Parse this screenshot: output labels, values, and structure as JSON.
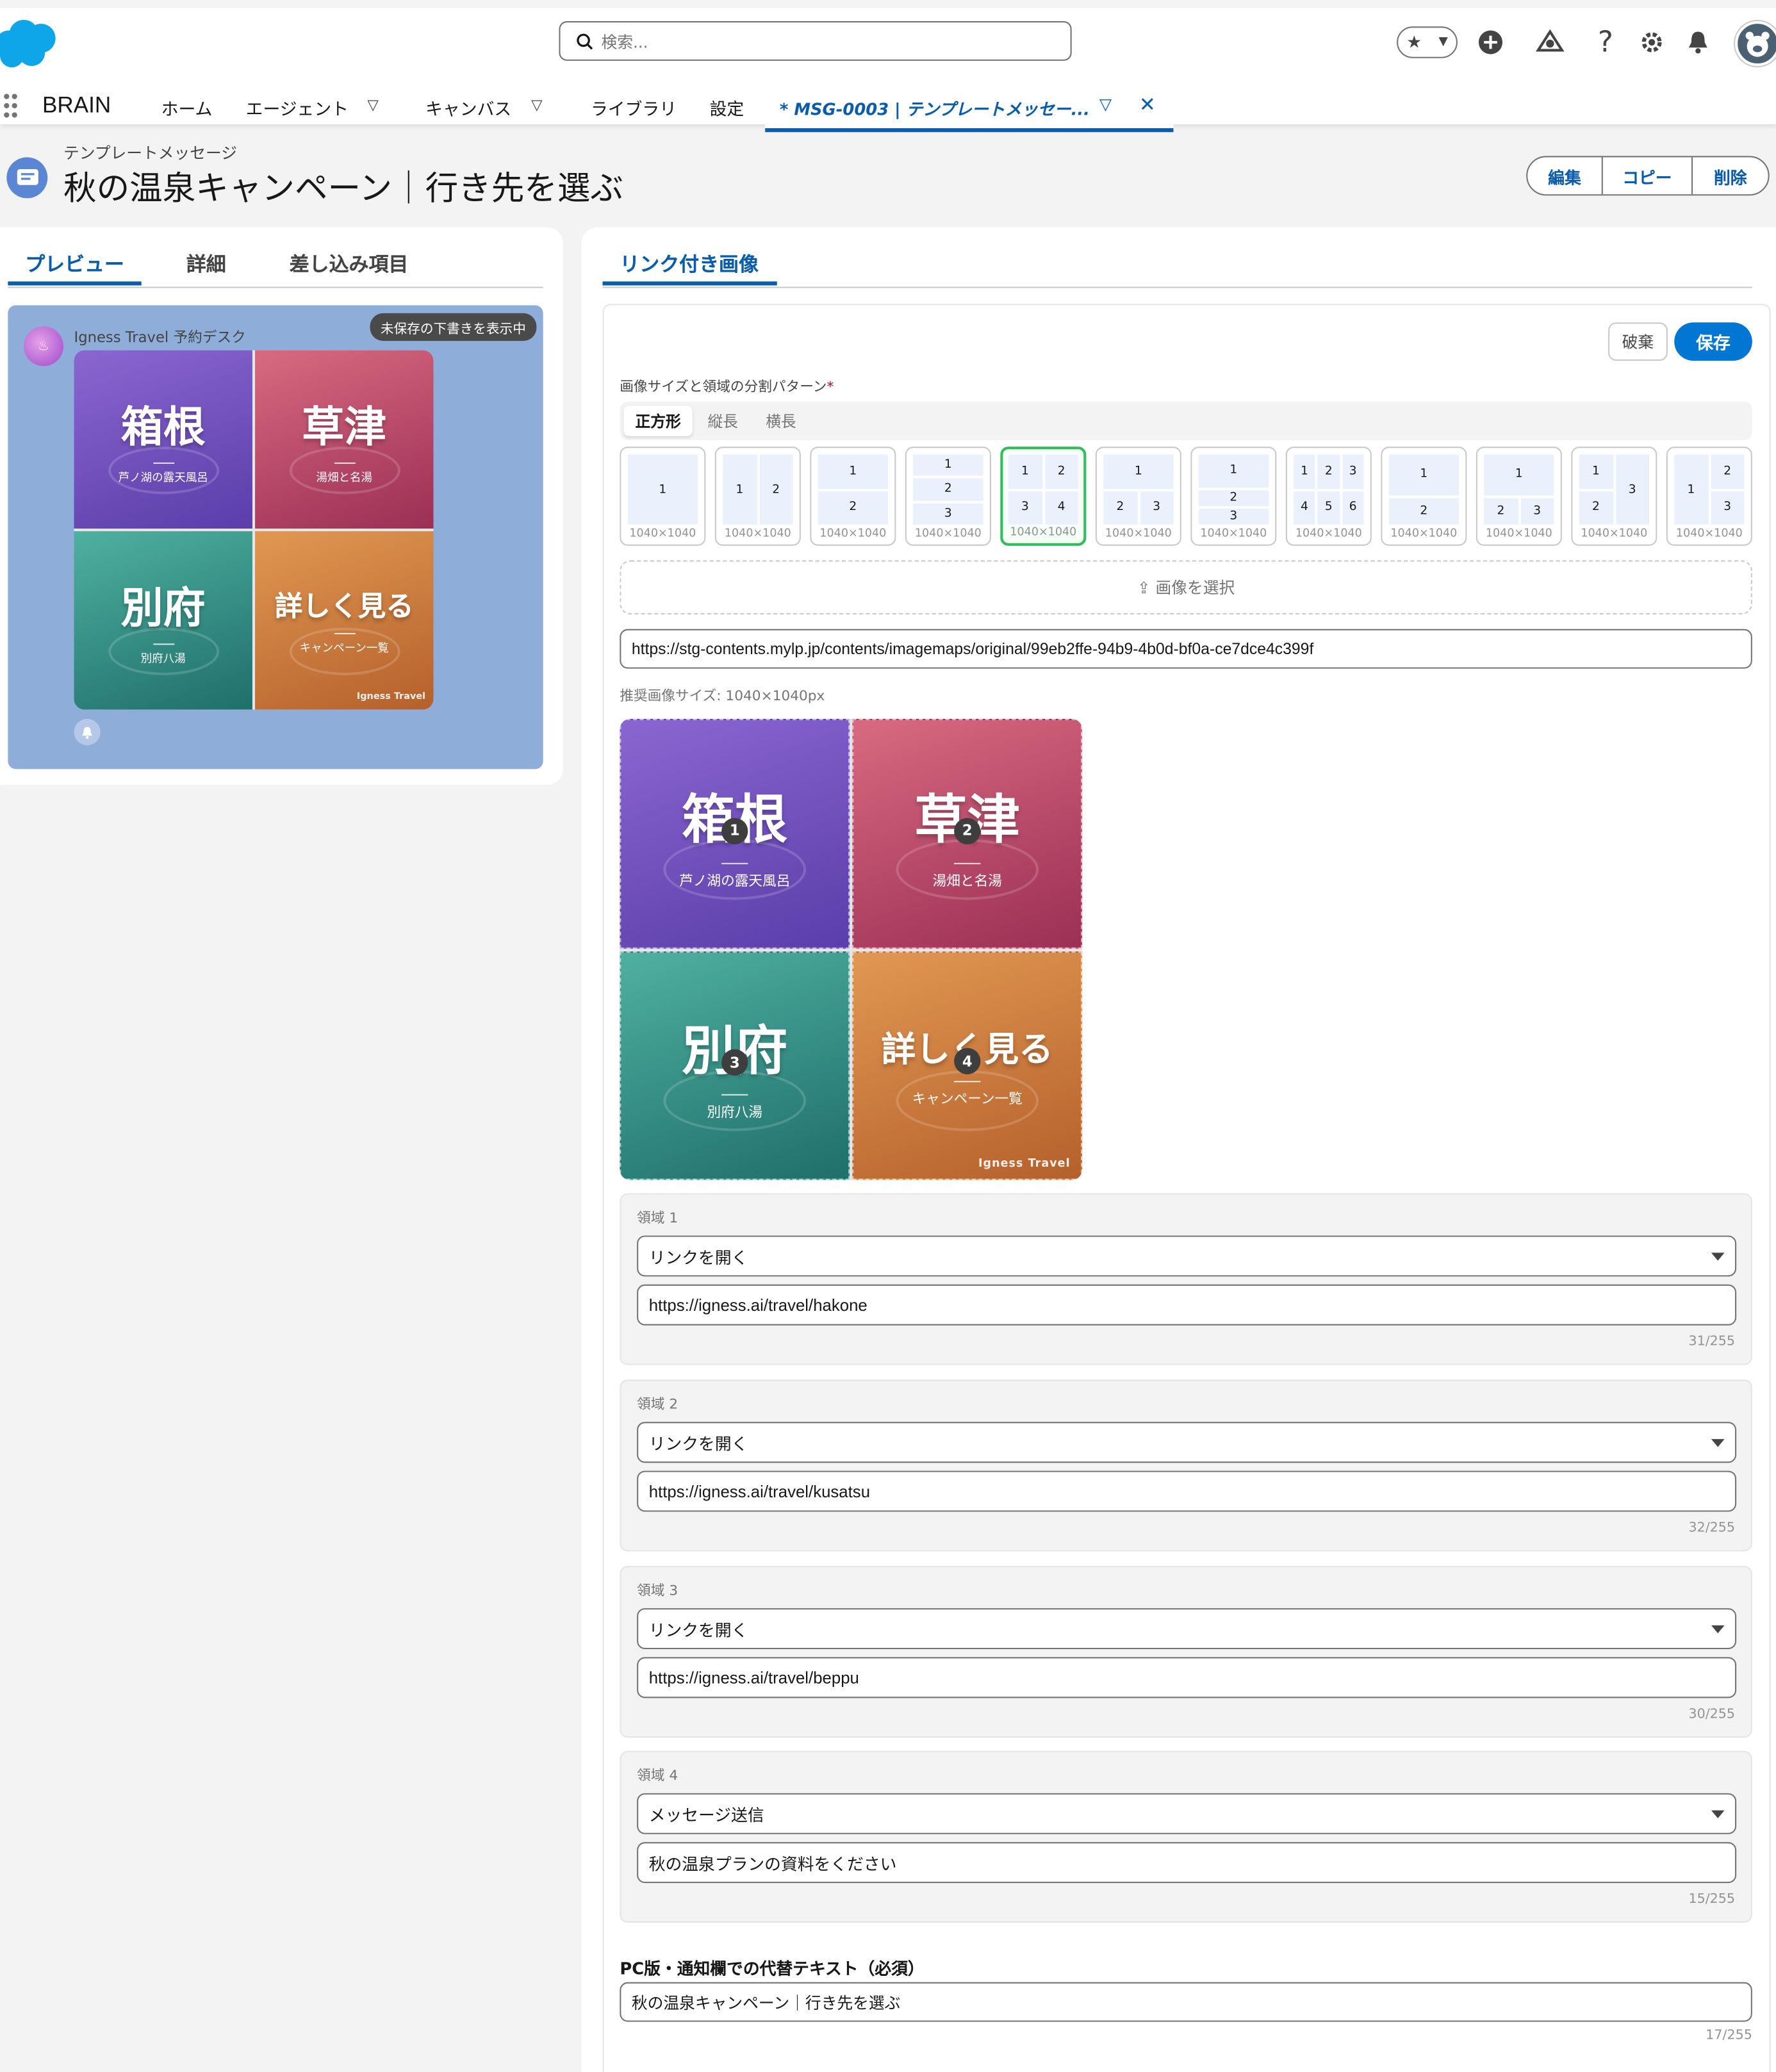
{
  "search": {
    "placeholder": "検索..."
  },
  "nav": {
    "app_name": "BRAIN",
    "items": [
      {
        "label": "ホーム"
      },
      {
        "label": "エージェント"
      },
      {
        "label": "キャンバス"
      },
      {
        "label": "ライブラリ"
      },
      {
        "label": "設定"
      }
    ],
    "active_tab": "* MSG-0003 | テンプレートメッセー..."
  },
  "page": {
    "object_label": "テンプレートメッセージ",
    "title": "秋の温泉キャンペーン｜行き先を選ぶ",
    "actions": {
      "edit": "編集",
      "copy": "コピー",
      "delete": "削除"
    }
  },
  "left": {
    "tabs": [
      {
        "label": "プレビュー"
      },
      {
        "label": "詳細"
      },
      {
        "label": "差し込み項目"
      }
    ],
    "preview": {
      "avatar_text": "♨",
      "sender": "Igness Travel 予約デスク",
      "badge": "未保存の下書きを表示中"
    }
  },
  "tiles": [
    {
      "title": "箱根",
      "subtitle": "芦ノ湖の露天風呂",
      "number": "1",
      "color": "#6a4cc0"
    },
    {
      "title": "草津",
      "subtitle": "湯畑と名湯",
      "number": "2",
      "color": "#bf4b68"
    },
    {
      "title": "別府",
      "subtitle": "別府八湯",
      "number": "3",
      "color": "#2f8a80"
    },
    {
      "title": "詳しく見る",
      "subtitle": "キャンペーン一覧",
      "number": "4",
      "color": "#cc7a3d"
    }
  ],
  "brand_mark": "Igness Travel",
  "right": {
    "tab": "リンク付き画像",
    "discard": "破棄",
    "save": "保存",
    "pattern_label": "画像サイズと領域の分割パターン",
    "required_mark": "*",
    "orientations": [
      {
        "label": "正方形"
      },
      {
        "label": "縦長"
      },
      {
        "label": "横長"
      }
    ],
    "pattern_caption": "1040×1040",
    "upload_label": "⇪ 画像を選択",
    "image_url": "https://stg-contents.mylp.jp/contents/imagemaps/original/99eb2ffe-94b9-4b0d-bf0a-ce7dce4c399f",
    "recommended": "推奨画像サイズ: 1040×1040px",
    "regions": [
      {
        "label": "領域 1",
        "action": "リンクを開く",
        "value": "https://igness.ai/travel/hakone",
        "count": "31/255"
      },
      {
        "label": "領域 2",
        "action": "リンクを開く",
        "value": "https://igness.ai/travel/kusatsu",
        "count": "32/255"
      },
      {
        "label": "領域 3",
        "action": "リンクを開く",
        "value": "https://igness.ai/travel/beppu",
        "count": "30/255"
      },
      {
        "label": "領域 4",
        "action": "メッセージ送信",
        "value": "秋の温泉プランの資料をください",
        "count": "15/255"
      }
    ],
    "alt_label": "PC版・通知欄での代替テキスト（必須）",
    "alt_value": "秋の温泉キャンペーン｜行き先を選ぶ",
    "alt_count": "17/255"
  }
}
